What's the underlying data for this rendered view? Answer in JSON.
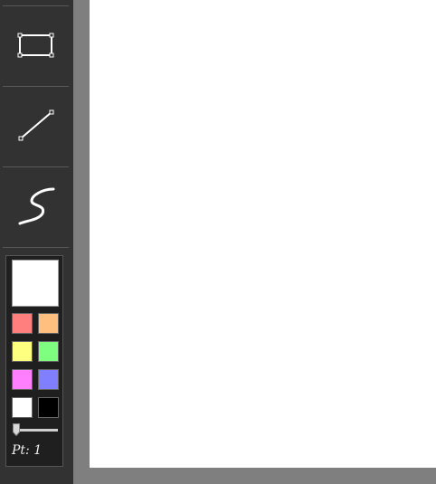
{
  "toolbar": {
    "tools": [
      {
        "name": "rectangle-tool",
        "icon": "rectangle-icon"
      },
      {
        "name": "line-tool",
        "icon": "line-icon"
      },
      {
        "name": "freehand-tool",
        "icon": "freehand-icon"
      }
    ]
  },
  "palette": {
    "current_color": "#ffffff",
    "swatches": [
      "#ff7f7f",
      "#ffbf7f",
      "#ffff7f",
      "#7fff7f",
      "#ff7fff",
      "#7f7fff",
      "#ffffff",
      "#000000"
    ],
    "point_size_label": "Pt: 1",
    "point_size": 1
  },
  "canvas": {
    "background": "#ffffff"
  }
}
